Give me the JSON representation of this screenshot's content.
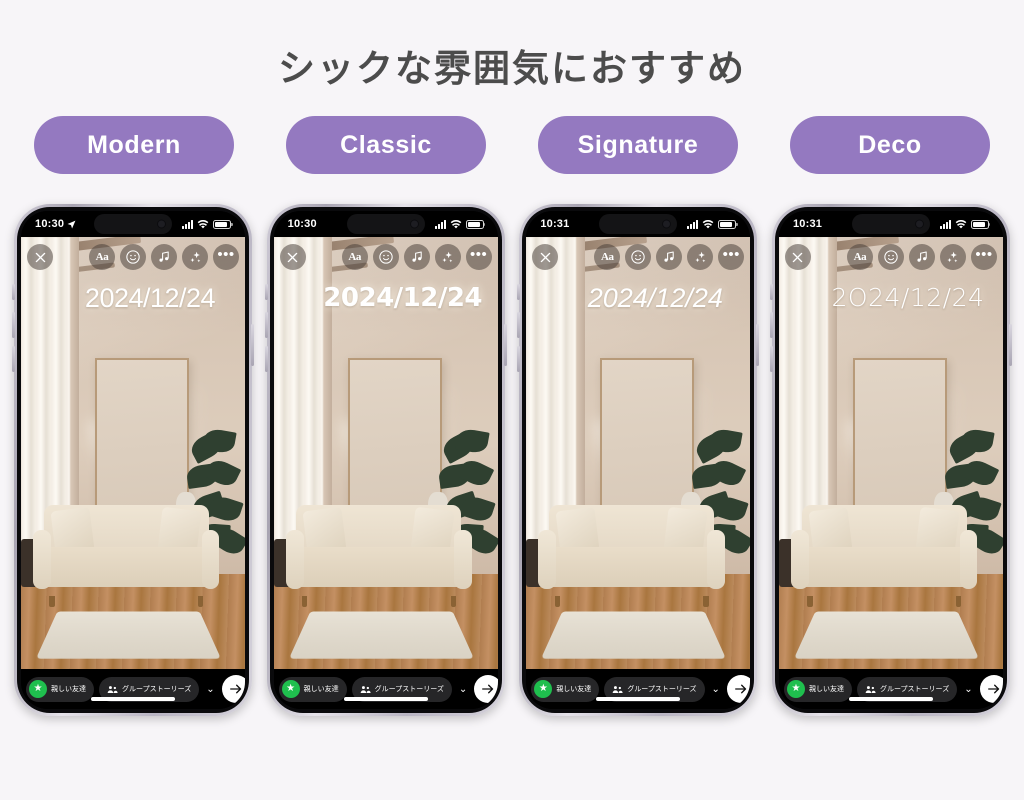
{
  "page": {
    "title": "シックな雰囲気におすすめ",
    "background_color": "#f7f5f8",
    "title_color": "#4c4c4c"
  },
  "style_tabs": {
    "accent_color": "#9479c0",
    "label_color": "#ffffff",
    "items": [
      {
        "label": "Modern"
      },
      {
        "label": "Classic"
      },
      {
        "label": "Signature"
      },
      {
        "label": "Deco"
      }
    ]
  },
  "phones": [
    {
      "style": "Modern",
      "status_bar": {
        "time": "10:30",
        "location_arrow": true,
        "signal_icon": "cellular-signal-icon",
        "wifi_icon": "wifi-icon",
        "battery_icon": "battery-icon"
      },
      "toolbar": {
        "close_label": "×",
        "text_label": "Aa",
        "sticker_icon": "sticker-face-icon",
        "music_icon": "music-note-icon",
        "effects_icon": "sparkles-icon",
        "more_label": "•••"
      },
      "overlay_text": "2024/12/24",
      "bottom_bar": {
        "close_friends_label": "親しい友達",
        "close_friends_badge_color": "#1fbf4e",
        "group_stories_label": "グループストーリーズ",
        "chevron_label": "⌄",
        "send_icon": "arrow-right-icon"
      }
    },
    {
      "style": "Classic",
      "status_bar": {
        "time": "10:30",
        "location_arrow": false,
        "signal_icon": "cellular-signal-icon",
        "wifi_icon": "wifi-icon",
        "battery_icon": "battery-icon"
      },
      "toolbar": {
        "close_label": "×",
        "text_label": "Aa",
        "sticker_icon": "sticker-face-icon",
        "music_icon": "music-note-icon",
        "effects_icon": "sparkles-icon",
        "more_label": "•••"
      },
      "overlay_text": "2024/12/24",
      "bottom_bar": {
        "close_friends_label": "親しい友達",
        "close_friends_badge_color": "#1fbf4e",
        "group_stories_label": "グループストーリーズ",
        "chevron_label": "⌄",
        "send_icon": "arrow-right-icon"
      }
    },
    {
      "style": "Signature",
      "status_bar": {
        "time": "10:31",
        "location_arrow": false,
        "signal_icon": "cellular-signal-icon",
        "wifi_icon": "wifi-icon",
        "battery_icon": "battery-icon"
      },
      "toolbar": {
        "close_label": "×",
        "text_label": "Aa",
        "sticker_icon": "sticker-face-icon",
        "music_icon": "music-note-icon",
        "effects_icon": "sparkles-icon",
        "more_label": "•••"
      },
      "overlay_text": "2024/12/24",
      "bottom_bar": {
        "close_friends_label": "親しい友達",
        "close_friends_badge_color": "#1fbf4e",
        "group_stories_label": "グループストーリーズ",
        "chevron_label": "⌄",
        "send_icon": "arrow-right-icon"
      }
    },
    {
      "style": "Deco",
      "status_bar": {
        "time": "10:31",
        "location_arrow": false,
        "signal_icon": "cellular-signal-icon",
        "wifi_icon": "wifi-icon",
        "battery_icon": "battery-icon"
      },
      "toolbar": {
        "close_label": "×",
        "text_label": "Aa",
        "sticker_icon": "sticker-face-icon",
        "music_icon": "music-note-icon",
        "effects_icon": "sparkles-icon",
        "more_label": "•••"
      },
      "overlay_text": "2О24/12/24",
      "bottom_bar": {
        "close_friends_label": "親しい友達",
        "close_friends_badge_color": "#1fbf4e",
        "group_stories_label": "グループストーリーズ",
        "chevron_label": "⌄",
        "send_icon": "arrow-right-icon"
      }
    }
  ]
}
